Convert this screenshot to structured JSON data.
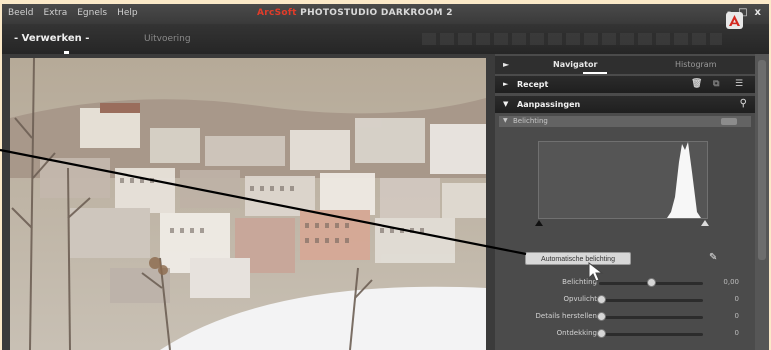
{
  "menubar": {
    "items": [
      "Beeld",
      "Extra",
      "Egnels",
      "Help"
    ],
    "title_brand": "ArcSoft",
    "title_rest": " PHOTOSTUDIO DARKROOM 2",
    "window_controls": [
      "-",
      "□",
      "x"
    ]
  },
  "tabbar": {
    "edit_tab": "- Verwerken -",
    "output_tab": "Uitvoering"
  },
  "panel": {
    "tabs": {
      "navigator": "Navigator",
      "histogram": "Histogram"
    },
    "sections": {
      "recept": "Recept",
      "aanpassingen": "Aanpassingen",
      "belichting": "Belichting"
    },
    "auto_button": "Automatische belichting",
    "sliders": [
      {
        "label": "Belichting",
        "value": "0,00",
        "level": 0.5
      },
      {
        "label": "Opvulicht",
        "value": "0",
        "level": 0.0
      },
      {
        "label": "Details herstellen",
        "value": "0",
        "level": 0.0
      },
      {
        "label": "Ontdekking",
        "value": "0",
        "level": 0.0
      }
    ]
  },
  "icons": {
    "recept_icons": [
      "trash-icon",
      "copy-icon",
      "list-icon"
    ],
    "search": "magnifier-icon",
    "eyedropper": "eyedropper-icon"
  },
  "colors": {
    "brand_red": "#e23c2a",
    "frame_cream": "#fbe9c8",
    "panel_bg": "#4b4b4b"
  }
}
